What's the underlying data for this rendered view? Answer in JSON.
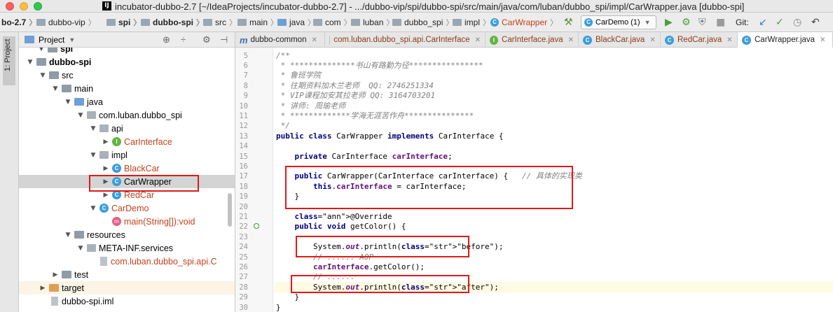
{
  "title": {
    "app_icon": "IJ",
    "text": "incubator-dubbo-2.7 [~/IdeaProjects/incubator-dubbo-2.7] - .../dubbo-vip/spi/dubbo-spi/src/main/java/com/luban/dubbo_spi/impl/CarWrapper.java [dubbo-spi]"
  },
  "breadcrumbs": [
    "bo-2.7",
    "dubbo-vip",
    "spi",
    "dubbo-spi",
    "src",
    "main",
    "java",
    "com",
    "luban",
    "dubbo_spi",
    "impl",
    "CarWrapper"
  ],
  "toolbar": {
    "run_config": "CarDemo (1)",
    "git_label": "Git:",
    "hammer_icon": "⚒",
    "run_icon": "▶",
    "debug_icon": "⚙",
    "stop_icon": "■",
    "update_icon": "↙",
    "commit_icon": "✓",
    "history_icon": "◷",
    "revert_icon": "↶"
  },
  "left_stripe": {
    "label": "1: Project"
  },
  "project_panel": {
    "title": "Project",
    "tree": [
      {
        "label": "spi",
        "icon": "folder",
        "bold": true
      },
      {
        "label": "dubbo-spi",
        "icon": "folder",
        "bold": true
      },
      {
        "label": "src",
        "icon": "folder"
      },
      {
        "label": "main",
        "icon": "folder"
      },
      {
        "label": "java",
        "icon": "folder-blue"
      },
      {
        "label": "com.luban.dubbo_spi",
        "icon": "package"
      },
      {
        "label": "api",
        "icon": "package"
      },
      {
        "label": "CarInterface",
        "icon": "interface",
        "vcs_changed": true
      },
      {
        "label": "impl",
        "icon": "package"
      },
      {
        "label": "BlackCar",
        "icon": "class",
        "vcs_changed": true
      },
      {
        "label": "CarWrapper",
        "icon": "class",
        "selected": true
      },
      {
        "label": "RedCar",
        "icon": "class",
        "vcs_changed": true
      },
      {
        "label": "CarDemo",
        "icon": "class",
        "vcs_changed": true
      },
      {
        "label": "main(String[]):void",
        "icon": "method",
        "vcs_changed": true
      },
      {
        "label": "resources",
        "icon": "folder"
      },
      {
        "label": "META-INF.services",
        "icon": "package"
      },
      {
        "label": "com.luban.dubbo_spi.api.C",
        "icon": "file",
        "vcs_changed": true
      },
      {
        "label": "test",
        "icon": "folder"
      },
      {
        "label": "target",
        "icon": "folder-orange"
      },
      {
        "label": "dubbo-spi.iml",
        "icon": "file"
      }
    ]
  },
  "editor_tabs": [
    {
      "label": "dubbo-common",
      "icon": "m"
    },
    {
      "label": "com.luban.dubbo_spi.api.CarInterface",
      "icon": "file"
    },
    {
      "label": "CarInterface.java",
      "icon": "interface"
    },
    {
      "label": "BlackCar.java",
      "icon": "class"
    },
    {
      "label": "RedCar.java",
      "icon": "class"
    },
    {
      "label": "CarWrapper.java",
      "icon": "class",
      "active": true
    }
  ],
  "code_lines": [
    {
      "n": "5",
      "text": "/**"
    },
    {
      "n": "6",
      "text": " * **************书山有路勤为径****************"
    },
    {
      "n": "7",
      "text": " * 鲁班学院"
    },
    {
      "n": "8",
      "text": " * 往期资料加木兰老师  QQ: 2746251334"
    },
    {
      "n": "9",
      "text": " * VIP课程加安其拉老师 QQ: 3164703201"
    },
    {
      "n": "10",
      "text": " * 讲师: 周瑜老师"
    },
    {
      "n": "11",
      "text": " * *************学海无涯苦作舟***************"
    },
    {
      "n": "12",
      "text": " */"
    },
    {
      "n": "13",
      "text": "public class CarWrapper implements CarInterface {"
    },
    {
      "n": "14",
      "text": ""
    },
    {
      "n": "15",
      "text": "    private CarInterface carInterface;"
    },
    {
      "n": "16",
      "text": ""
    },
    {
      "n": "17",
      "text": "    public CarWrapper(CarInterface carInterface) {   // 具体的实现类"
    },
    {
      "n": "18",
      "text": "        this.carInterface = carInterface;"
    },
    {
      "n": "19",
      "text": "    }"
    },
    {
      "n": "20",
      "text": ""
    },
    {
      "n": "21",
      "text": "    @Override"
    },
    {
      "n": "22",
      "text": "    public void getColor() {"
    },
    {
      "n": "23",
      "text": ""
    },
    {
      "n": "24",
      "text": "        System.out.println(\"before\");"
    },
    {
      "n": "25",
      "text": "        // ...... AOP"
    },
    {
      "n": "26",
      "text": "        carInterface.getColor();"
    },
    {
      "n": "27",
      "text": "        // ......"
    },
    {
      "n": "28",
      "text": "        System.out.println(\"after\");"
    },
    {
      "n": "29",
      "text": "    }"
    },
    {
      "n": "30",
      "text": "}"
    }
  ],
  "colors": {
    "keyword": "#000080",
    "comment": "#808080",
    "annotation": "#808000",
    "field": "#660e7a",
    "string": "#008000",
    "highlight_box": "#e1191a",
    "vcs_changed": "#c2421a"
  }
}
